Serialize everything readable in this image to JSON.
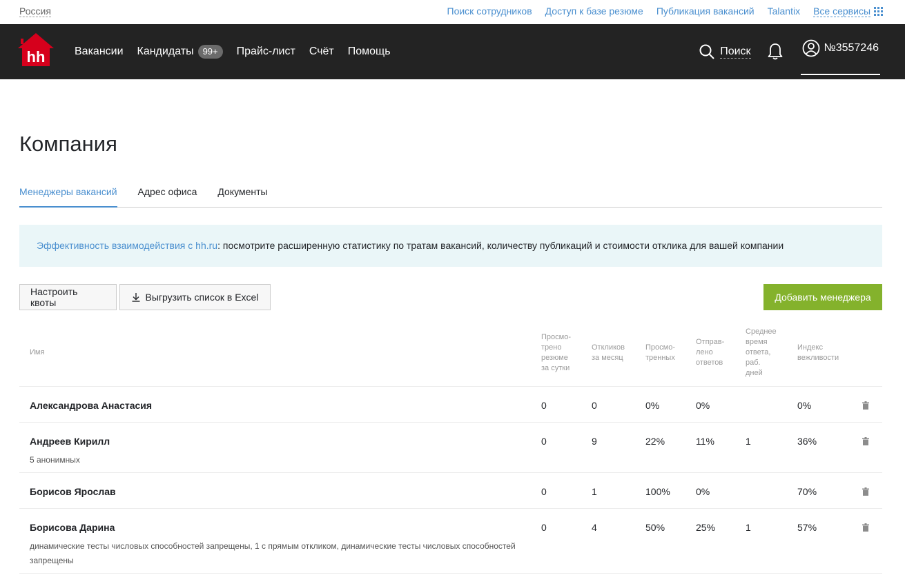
{
  "topbar": {
    "region": "Россия",
    "links": [
      "Поиск сотрудников",
      "Доступ к базе резюме",
      "Публикация вакансий",
      "Talantix"
    ],
    "all_services": "Все сервисы"
  },
  "navbar": {
    "logo_text": "hh",
    "items": [
      {
        "label": "Вакансии"
      },
      {
        "label": "Кандидаты",
        "badge": "99+"
      },
      {
        "label": "Прайс-лист"
      },
      {
        "label": "Счёт"
      },
      {
        "label": "Помощь"
      }
    ],
    "search_label": "Поиск",
    "account_label": "№3557246"
  },
  "page": {
    "title": "Компания",
    "tabs": [
      "Менеджеры вакансий",
      "Адрес офиса",
      "Документы"
    ],
    "active_tab": 0,
    "info_link": "Эффективность взаимодействия с hh.ru",
    "info_text": ": посмотрите расширенную статистику по тратам вакансий, количеству публикаций и стоимости отклика для вашей компании"
  },
  "toolbar": {
    "quota_label": "Настроить квоты",
    "excel_label": "Выгрузить список в Excel",
    "add_label": "Добавить менеджера"
  },
  "table": {
    "headers": {
      "name": "Имя",
      "viewed_resumes": [
        "Просмо-",
        "трено",
        "резюме",
        "за сутки"
      ],
      "responses": [
        "Откликов",
        "за месяц"
      ],
      "viewed": [
        "Просмо-",
        "тренных"
      ],
      "sent": [
        "Отправ-",
        "лено",
        "ответов"
      ],
      "avg_time": [
        "Среднее",
        "время",
        "ответа,",
        "раб.",
        "дней"
      ],
      "politeness": [
        "Индекс",
        "вежливости"
      ]
    },
    "rows": [
      {
        "name": "Александрова Анастасия",
        "note": "",
        "viewed_resumes": "0",
        "responses": "0",
        "viewed": "0%",
        "sent": "0%",
        "avg_time": "",
        "politeness": "0%"
      },
      {
        "name": "Андреев Кирилл",
        "note": "5 анонимных",
        "viewed_resumes": "0",
        "responses": "9",
        "viewed": "22%",
        "sent": "11%",
        "avg_time": "1",
        "politeness": "36%"
      },
      {
        "name": "Борисов Ярослав",
        "note": "",
        "viewed_resumes": "0",
        "responses": "1",
        "viewed": "100%",
        "sent": "0%",
        "avg_time": "",
        "politeness": "70%"
      },
      {
        "name": "Борисова Дарина",
        "note": "динамические тесты числовых способностей запрещены, 1 с прямым откликом, динамические тесты числовых способностей запрещены",
        "viewed_resumes": "0",
        "responses": "4",
        "viewed": "50%",
        "sent": "25%",
        "avg_time": "1",
        "politeness": "57%"
      }
    ]
  },
  "colors": {
    "link": "#4a8fcf",
    "nav_bg": "#232323",
    "info_bg": "#eaf6f8",
    "add_button": "#84b22c",
    "logo_red": "#d6001c"
  }
}
